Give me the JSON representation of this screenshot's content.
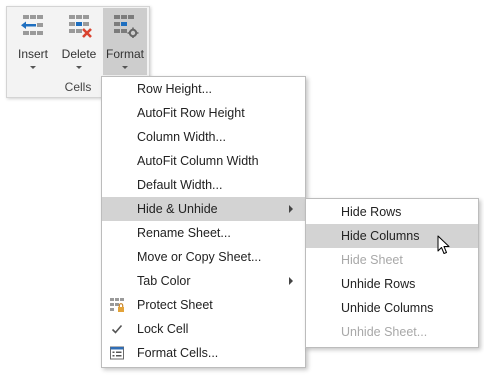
{
  "ribbon": {
    "buttons": [
      {
        "label": "Insert",
        "icon": "insert-cells-icon"
      },
      {
        "label": "Delete",
        "icon": "delete-cells-icon"
      },
      {
        "label": "Format",
        "icon": "format-cells-icon"
      }
    ],
    "group_label": "Cells"
  },
  "format_menu": {
    "items": [
      {
        "label": "Row Height..."
      },
      {
        "label": "AutoFit Row Height"
      },
      {
        "label": "Column Width..."
      },
      {
        "label": "AutoFit Column Width"
      },
      {
        "label": "Default Width..."
      },
      {
        "label": "Hide & Unhide",
        "has_submenu": true,
        "highlighted": true
      },
      {
        "label": "Rename Sheet..."
      },
      {
        "label": "Move or Copy Sheet..."
      },
      {
        "label": "Tab Color",
        "has_submenu": true
      },
      {
        "label": "Protect Sheet",
        "icon": "protect-sheet-icon"
      },
      {
        "label": "Lock Cell",
        "icon": "checkmark-icon"
      },
      {
        "label": "Format Cells...",
        "icon": "format-cells-dialog-icon"
      }
    ]
  },
  "hide_unhide_submenu": {
    "items": [
      {
        "label": "Hide Rows",
        "enabled": true
      },
      {
        "label": "Hide Columns",
        "enabled": true,
        "highlighted": true
      },
      {
        "label": "Hide Sheet",
        "enabled": false
      },
      {
        "label": "Unhide Rows",
        "enabled": true
      },
      {
        "label": "Unhide Columns",
        "enabled": true
      },
      {
        "label": "Unhide Sheet...",
        "enabled": false
      }
    ]
  },
  "colors": {
    "highlight": "#d3d3d3",
    "ribbon_bg": "#f3f3f3",
    "insert_arrow": "#1e6fc0",
    "delete_x": "#d9432f",
    "disabled_text": "#a8a8a8"
  }
}
